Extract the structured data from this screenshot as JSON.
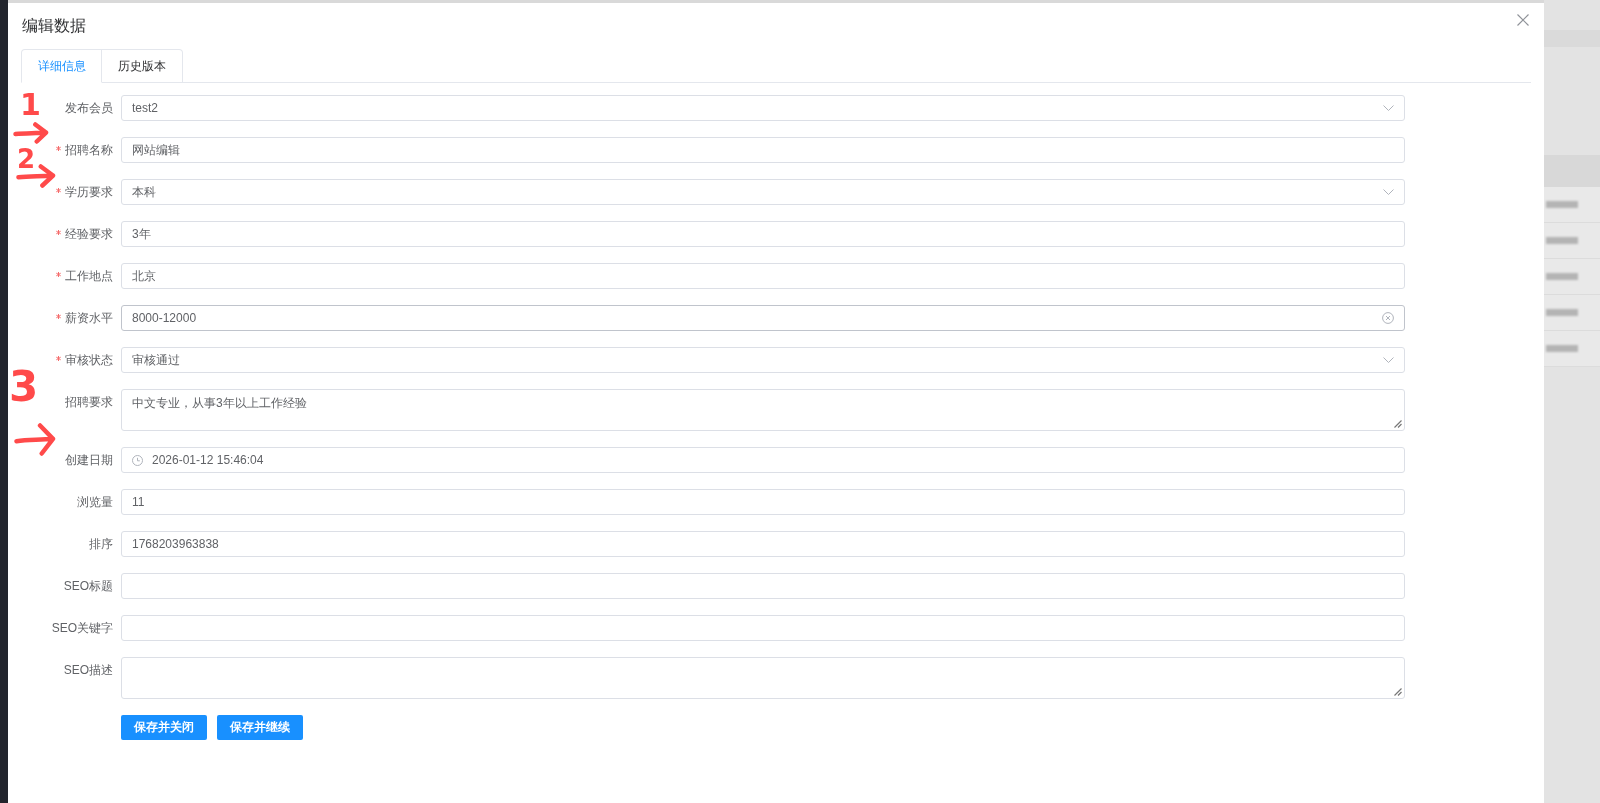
{
  "dialog": {
    "title": "编辑数据",
    "tabs": [
      {
        "label": "详细信息",
        "selected": true
      },
      {
        "label": "历史版本",
        "selected": false
      }
    ],
    "fields": [
      {
        "label": "发布会员",
        "required": false,
        "kind": "select",
        "value": "test2",
        "hovered": false
      },
      {
        "label": "招聘名称",
        "required": true,
        "kind": "text",
        "value": "网站编辑",
        "hovered": false
      },
      {
        "label": "学历要求",
        "required": true,
        "kind": "select",
        "value": "本科",
        "hovered": false
      },
      {
        "label": "经验要求",
        "required": true,
        "kind": "text",
        "value": "3年",
        "hovered": false
      },
      {
        "label": "工作地点",
        "required": true,
        "kind": "text",
        "value": "北京",
        "hovered": false
      },
      {
        "label": "薪资水平",
        "required": true,
        "kind": "text",
        "value": "8000-12000",
        "hovered": true
      },
      {
        "label": "审核状态",
        "required": true,
        "kind": "select",
        "value": "审核通过",
        "hovered": false
      },
      {
        "label": "招聘要求",
        "required": false,
        "kind": "textarea",
        "value": "中文专业，从事3年以上工作经验",
        "hovered": false
      },
      {
        "label": "创建日期",
        "required": false,
        "kind": "date",
        "value": "2026-01-12 15:46:04",
        "hovered": false
      },
      {
        "label": "浏览量",
        "required": false,
        "kind": "text",
        "value": "11",
        "hovered": false
      },
      {
        "label": "排序",
        "required": false,
        "kind": "text",
        "value": "1768203963838",
        "hovered": false
      },
      {
        "label": "SEO标题",
        "required": false,
        "kind": "text",
        "hovered": false
      },
      {
        "label": "SEO关键字",
        "required": false,
        "kind": "text",
        "hovered": false
      },
      {
        "label": "SEO描述",
        "required": false,
        "kind": "textarea",
        "hovered": false
      }
    ],
    "buttons": [
      {
        "label": "保存并关闭"
      },
      {
        "label": "保存并继续"
      }
    ]
  },
  "annotations": [
    {
      "kind": "number",
      "text": "1"
    },
    {
      "kind": "arrow"
    },
    {
      "kind": "number",
      "text": "2"
    },
    {
      "kind": "arrow"
    },
    {
      "kind": "number",
      "text": "3"
    },
    {
      "kind": "arrow"
    }
  ]
}
